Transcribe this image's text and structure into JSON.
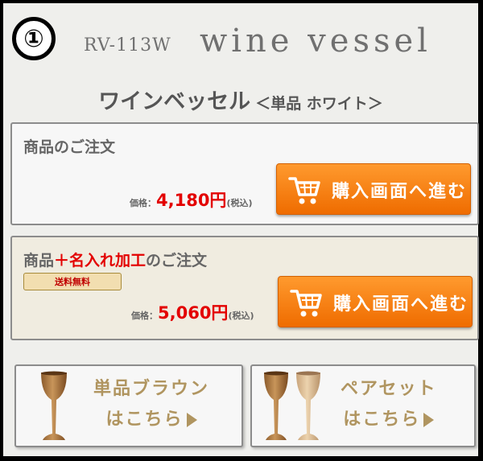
{
  "header": {
    "number_badge": "①",
    "model_code": "RV-113W",
    "product_name_en": "wine vessel"
  },
  "title": {
    "main": "ワインベッセル",
    "sub": "＜単品 ホワイト＞"
  },
  "order_single": {
    "heading": "商品のご注文",
    "price_label": "価格：",
    "price_value": "4,180円",
    "tax_note": "(税込)",
    "button_label": "購入画面へ進む"
  },
  "order_engraving": {
    "heading_prefix": "商品",
    "heading_highlight": "＋名入れ加工",
    "heading_suffix": "のご注文",
    "badge": "送料無料",
    "price_label": "価格：",
    "price_value": "5,060円",
    "tax_note": "(税込)",
    "button_label": "購入画面へ進む"
  },
  "links": {
    "brown": {
      "line1": "単品ブラウン",
      "line2": "はこちら"
    },
    "pair": {
      "line1": "ペアセット",
      "line2": "はこちら"
    }
  },
  "colors": {
    "accent_orange": "#f28000",
    "price_red": "#e30000",
    "gold_text": "#b09560"
  },
  "icons": [
    "cart-icon",
    "wine-glass-icon",
    "triangle-right-icon"
  ]
}
